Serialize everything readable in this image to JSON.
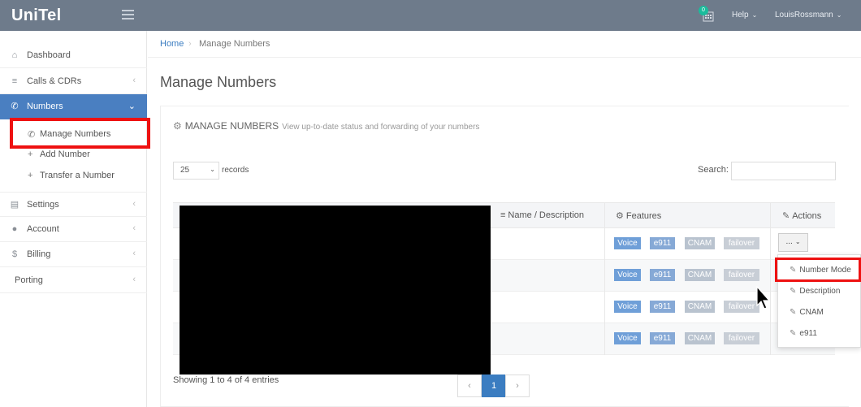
{
  "app": {
    "logo": "UniTel"
  },
  "topbar": {
    "notification_count": "0",
    "help_label": "Help",
    "user_name": "LouisRossmann",
    "caret": "⌄"
  },
  "sidebar": {
    "items": [
      {
        "label": "Dashboard",
        "icon": "home-icon",
        "glyph": "⌂"
      },
      {
        "label": "Calls & CDRs",
        "icon": "list-icon",
        "glyph": "≡",
        "chevron": "‹"
      },
      {
        "label": "Numbers",
        "icon": "phone-icon",
        "glyph": "✆",
        "chevron": "⌄"
      },
      {
        "label": "Settings",
        "icon": "settings-icon",
        "glyph": "▤",
        "chevron": "‹"
      },
      {
        "label": "Account",
        "icon": "user-icon",
        "glyph": "●",
        "chevron": "‹"
      },
      {
        "label": "Billing",
        "icon": "dollar-icon",
        "glyph": "$",
        "chevron": "‹"
      },
      {
        "label": "Porting",
        "chevron": "‹"
      }
    ],
    "subitems": [
      {
        "label": "Manage Numbers",
        "glyph": "✆"
      },
      {
        "label": "Add Number",
        "glyph": "+"
      },
      {
        "label": "Transfer a Number",
        "glyph": "+"
      }
    ]
  },
  "breadcrumb": {
    "home": "Home",
    "sep": "›",
    "current": "Manage Numbers"
  },
  "page": {
    "title": "Manage Numbers"
  },
  "panel": {
    "title": "MANAGE NUMBERS",
    "subtitle": "View up-to-date status and forwarding of your numbers",
    "length_value": "25",
    "records_label": "records",
    "search_label": "Search:",
    "search_value": ""
  },
  "table": {
    "columns": [
      {
        "label": "Name / Description",
        "icon": "list-icon",
        "glyph": "≡"
      },
      {
        "label": "Features",
        "icon": "cogs-icon",
        "glyph": "⚙"
      },
      {
        "label": "Actions",
        "icon": "wrench-icon",
        "glyph": "🔧"
      }
    ],
    "rows": [
      {
        "tags": [
          "Voice",
          "e911",
          "CNAM",
          "failover"
        ]
      },
      {
        "tags": [
          "Voice",
          "e911",
          "CNAM",
          "failover"
        ]
      },
      {
        "tags": [
          "Voice",
          "e911",
          "CNAM",
          "failover"
        ]
      },
      {
        "tags": [
          "Voice",
          "e911",
          "CNAM",
          "failover"
        ]
      }
    ],
    "action_button": "...",
    "action_menu": [
      "Number Mode",
      "Description",
      "CNAM",
      "e911"
    ]
  },
  "footer": {
    "showing": "Showing 1 to 4 of 4 entries",
    "prev": "‹",
    "page": "1",
    "next": "›"
  },
  "colors": {
    "topbar": "#6e7b8b",
    "accent": "#4a7fc1",
    "link": "#3b7dc1",
    "highlight": "#ee1111"
  }
}
